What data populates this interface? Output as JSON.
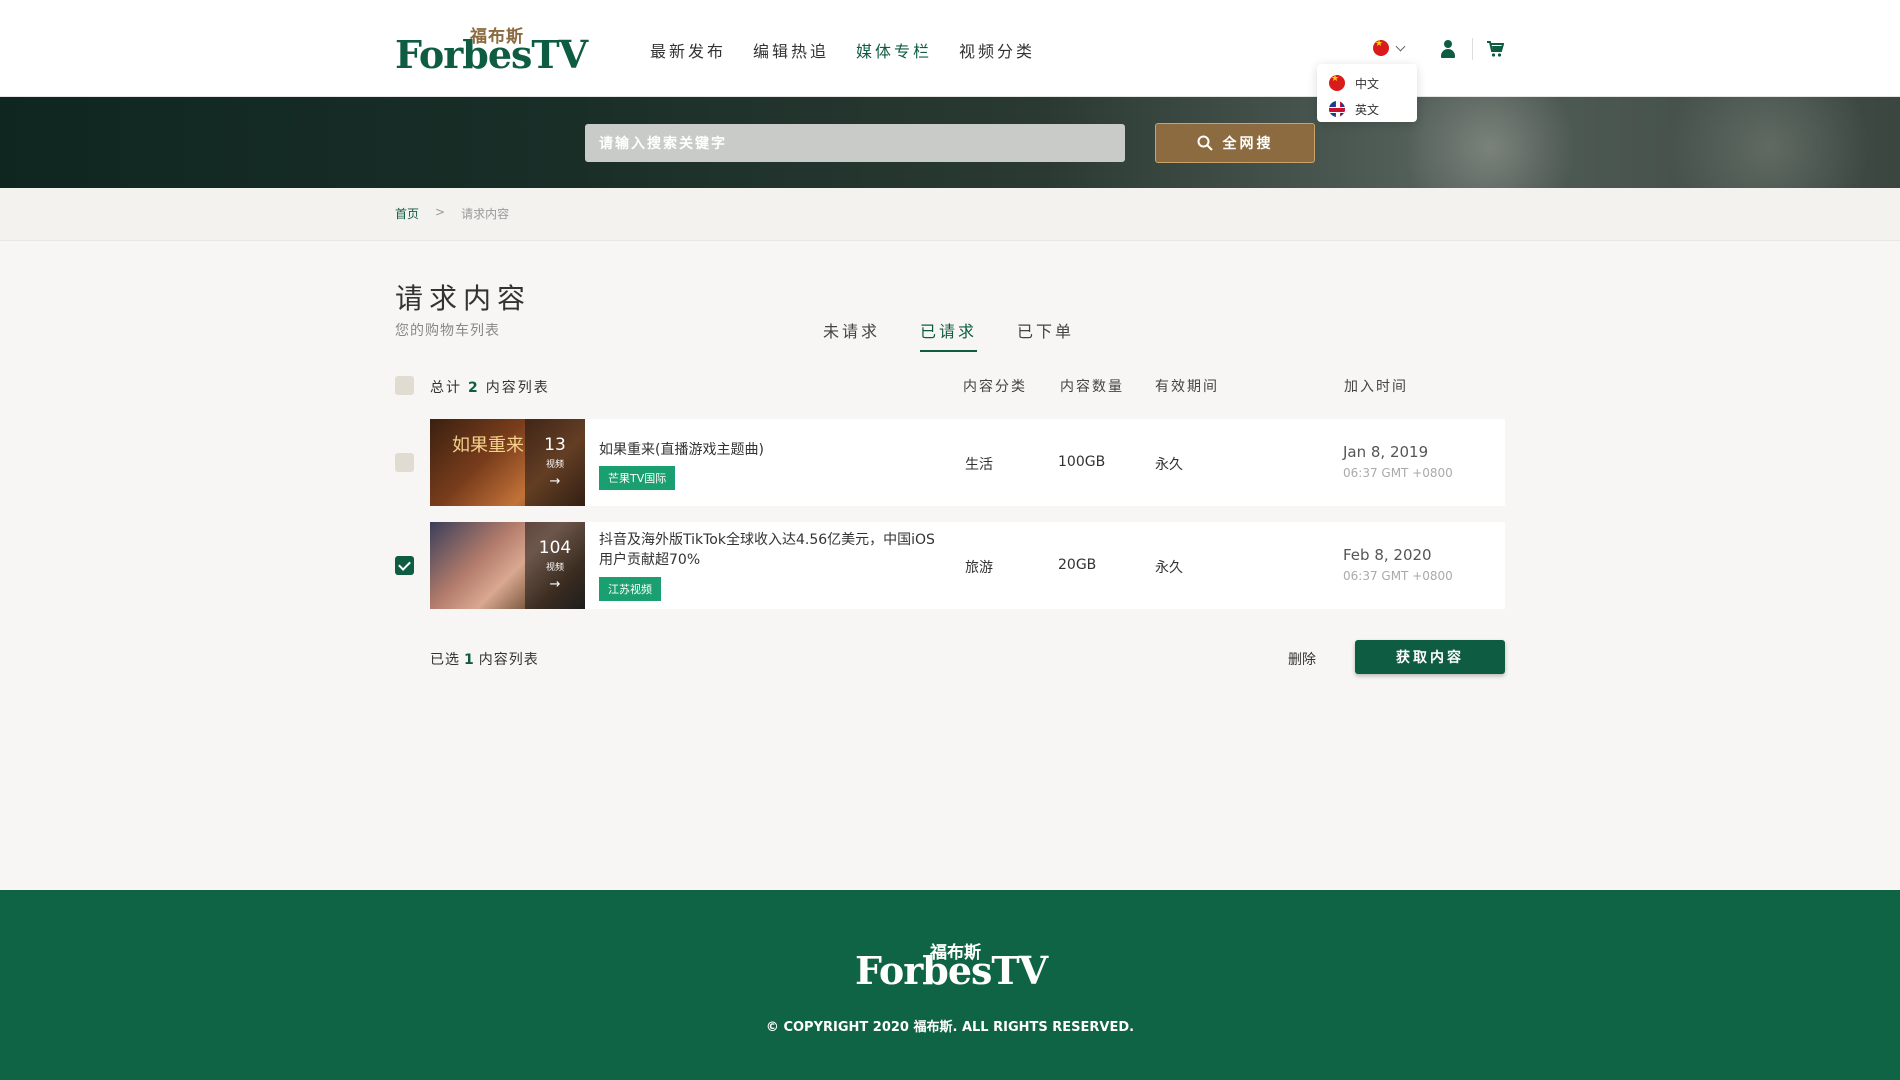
{
  "brand": {
    "logo_cn": "福布斯",
    "logo_en": "ForbesTV"
  },
  "nav": {
    "items": [
      "最新发布",
      "编辑热追",
      "媒体专栏",
      "视频分类"
    ],
    "active": "媒体专栏"
  },
  "lang": {
    "options": [
      "中文",
      "英文"
    ]
  },
  "search": {
    "placeholder": "请输入搜索关键字",
    "button_label": "全网搜"
  },
  "breadcrumb": {
    "home": "首页",
    "sep": ">",
    "current": "请求内容"
  },
  "page": {
    "title": "请求内容",
    "subtitle": "您的购物车列表"
  },
  "tabs": [
    {
      "label": "未请求",
      "active": false
    },
    {
      "label": "已请求",
      "active": true
    },
    {
      "label": "已下单",
      "active": false
    }
  ],
  "table": {
    "total_prefix": "总计",
    "total_count": "2",
    "total_suffix": "内容列表",
    "columns": [
      "内容分类",
      "内容数量",
      "有效期间",
      "加入时间"
    ]
  },
  "rows": [
    {
      "checked": false,
      "thumb_title": "如果重来",
      "video_count": "13",
      "video_label": "视频",
      "title": "如果重来(直播游戏主题曲)",
      "tag": "芒果TV国际",
      "category": "生活",
      "size": "100GB",
      "period": "永久",
      "date": "Jan 8, 2019",
      "time": "06:37 GMT +0800"
    },
    {
      "checked": true,
      "thumb_title": "",
      "video_count": "104",
      "video_label": "视频",
      "title": "抖音及海外版TikTok全球收入达4.56亿美元，中国iOS用户贡献超70%",
      "tag": "江苏视频",
      "category": "旅游",
      "size": "20GB",
      "period": "永久",
      "date": "Feb 8, 2020",
      "time": "06:37 GMT +0800"
    }
  ],
  "selection": {
    "prefix": "已选",
    "count": "1",
    "suffix": "内容列表"
  },
  "actions": {
    "delete": "删除",
    "get": "获取内容"
  },
  "footer": {
    "logo_cn": "福布斯",
    "logo_en": "ForbesTV",
    "copyright": "© COPYRIGHT 2020 福布斯. ALL RIGHTS RESERVED."
  },
  "colors": {
    "brand_green": "#0e5c42",
    "gold": "#8b6b3f",
    "tag_green": "#1aa070"
  }
}
